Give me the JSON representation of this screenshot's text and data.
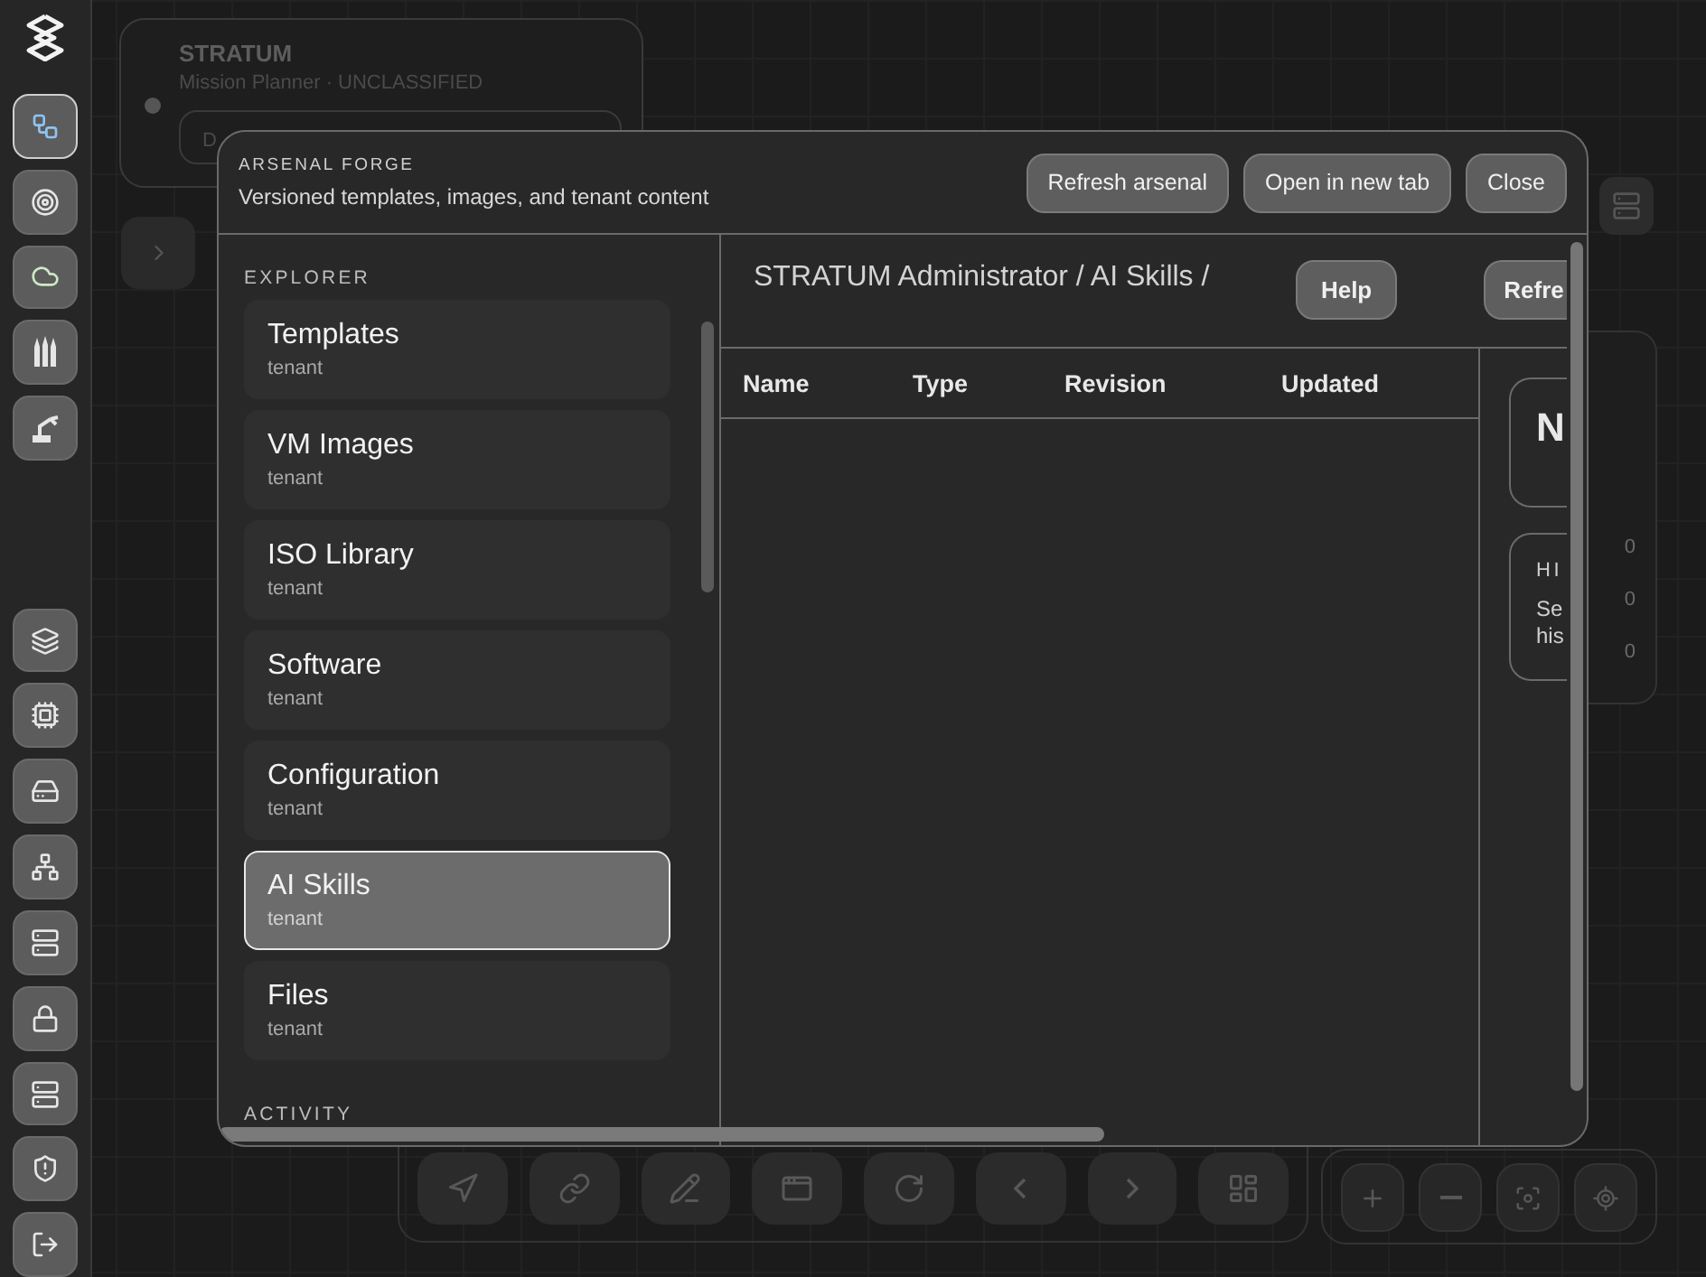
{
  "rail": {
    "top": [
      {
        "selected": true
      },
      {
        "selected": false
      },
      {
        "selected": false
      },
      {
        "selected": false
      },
      {
        "selected": false
      }
    ],
    "bottom": [
      {
        "selected": false
      },
      {
        "selected": false
      },
      {
        "selected": false
      },
      {
        "selected": false
      },
      {
        "selected": false
      },
      {
        "selected": false
      },
      {
        "selected": false
      },
      {
        "selected": false
      },
      {
        "selected": false
      }
    ]
  },
  "mission_card": {
    "title": "STRATUM",
    "subtitle": "Mission Planner · UNCLASSIFIED",
    "field": "D"
  },
  "side_panel": {
    "counts": [
      "0",
      "0",
      "0"
    ]
  },
  "modal": {
    "eyebrow": "ARSENAL FORGE",
    "subtitle": "Versioned templates, images, and tenant content",
    "buttons": [
      "Refresh arsenal",
      "Open in new tab",
      "Close"
    ],
    "explorer": {
      "heading": "EXPLORER",
      "items": [
        {
          "label": "Templates",
          "scope": "tenant",
          "selected": false
        },
        {
          "label": "VM Images",
          "scope": "tenant",
          "selected": false
        },
        {
          "label": "ISO Library",
          "scope": "tenant",
          "selected": false
        },
        {
          "label": "Software",
          "scope": "tenant",
          "selected": false
        },
        {
          "label": "Configuration",
          "scope": "tenant",
          "selected": false
        },
        {
          "label": "AI Skills",
          "scope": "tenant",
          "selected": true
        },
        {
          "label": "Files",
          "scope": "tenant",
          "selected": false
        }
      ],
      "next_heading": "ACTIVITY"
    },
    "breadcrumb": "STRATUM Administrator / AI Skills /",
    "help_button": "Help",
    "refresh_button": "Refre",
    "table": {
      "columns": [
        "Name",
        "Type",
        "Revision",
        "Updated"
      ]
    },
    "details": {
      "card_title": "N",
      "history_heading": "HI",
      "history_text": "Se his"
    }
  }
}
